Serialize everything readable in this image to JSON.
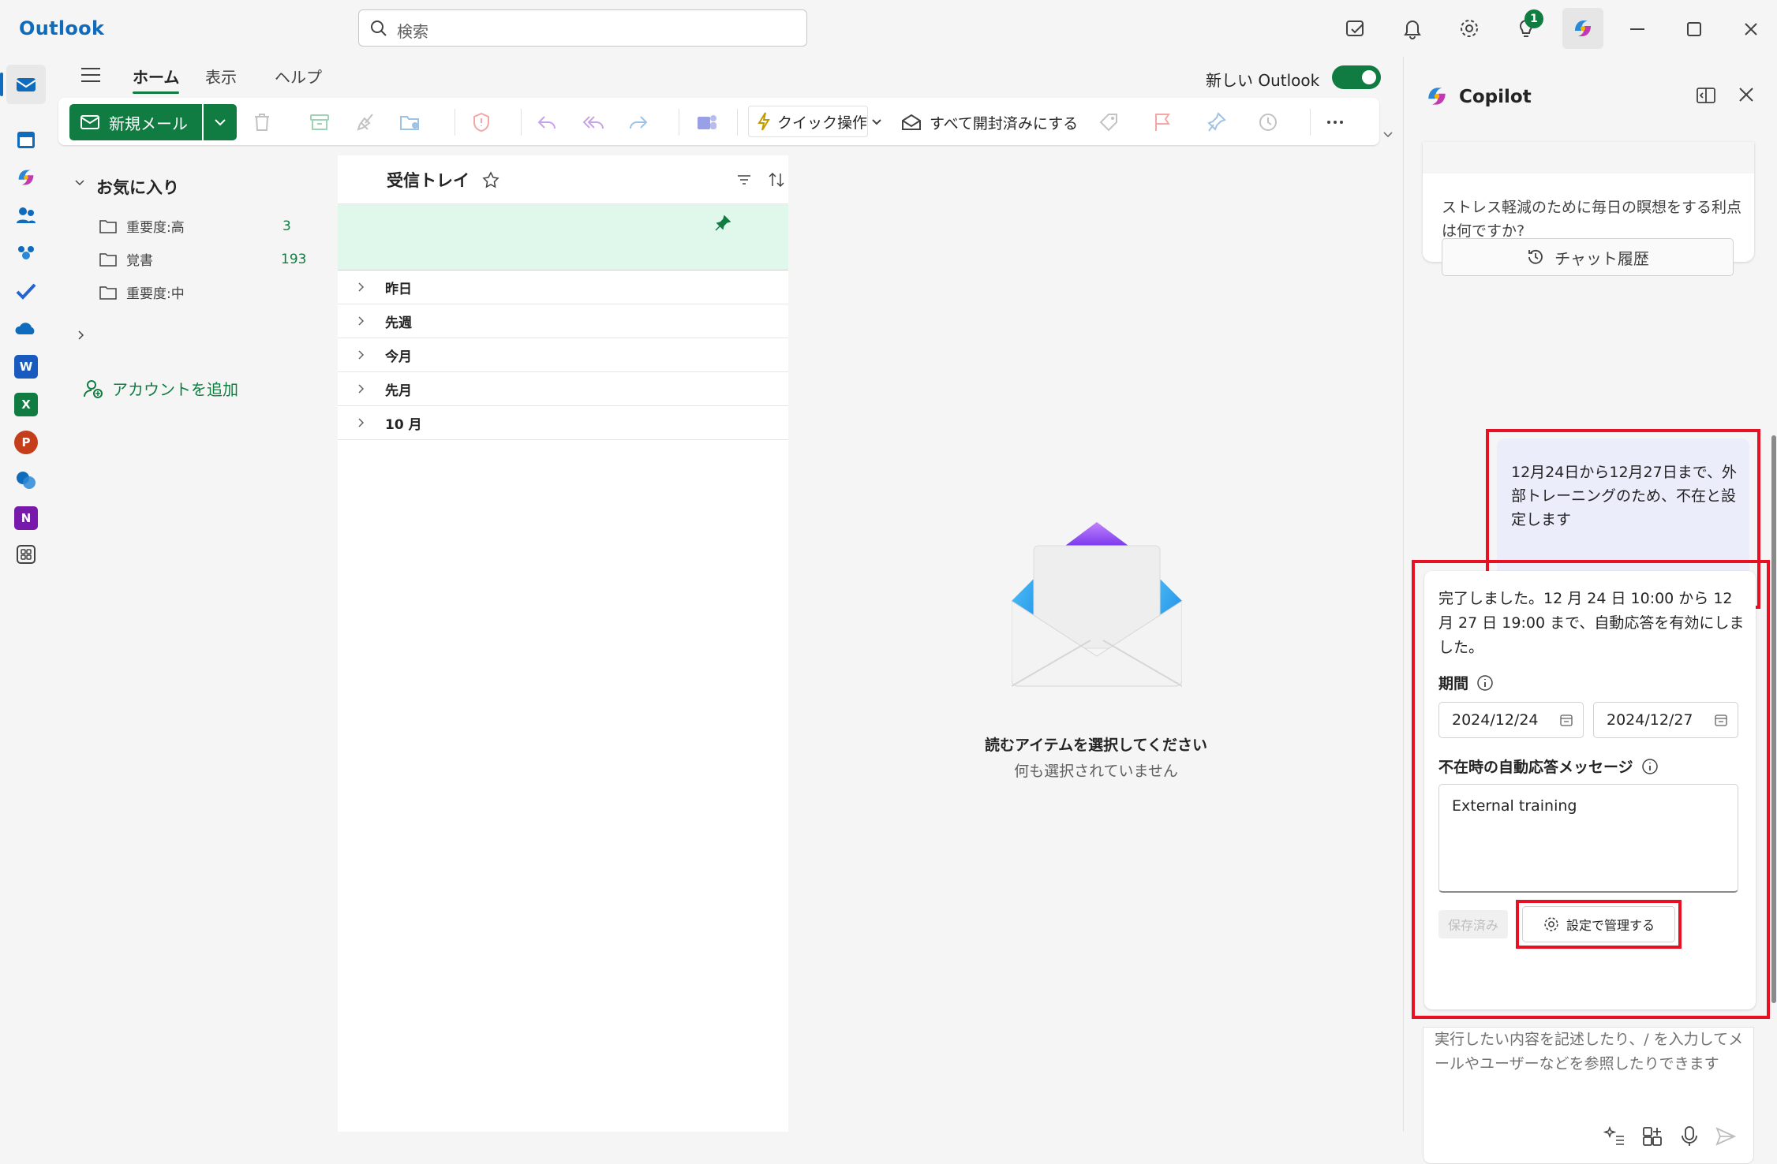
{
  "app": {
    "title": "Outlook"
  },
  "search": {
    "placeholder": "検索"
  },
  "titlebar": {
    "tips_badge": "1"
  },
  "ribbon": {
    "tabs": [
      {
        "label": "ホーム"
      },
      {
        "label": "表示"
      },
      {
        "label": "ヘルプ"
      }
    ],
    "new_outlook_label": "新しい Outlook",
    "new_mail_label": "新規メール",
    "quick_steps_label": "クイック操作",
    "mark_all_read_label": "すべて開封済みにする"
  },
  "folders": {
    "favorites_label": "お気に入り",
    "items": [
      {
        "name": "重要度:高",
        "count": "3"
      },
      {
        "name": "覚書",
        "count": "193"
      },
      {
        "name": "重要度:中",
        "count": ""
      }
    ],
    "add_account_label": "アカウントを追加"
  },
  "message_list": {
    "title": "受信トレイ",
    "groups": [
      {
        "label": "昨日"
      },
      {
        "label": "先週"
      },
      {
        "label": "今月"
      },
      {
        "label": "先月"
      },
      {
        "label": "10 月"
      }
    ]
  },
  "reading_pane": {
    "empty_title": "読むアイテムを選択してください",
    "empty_subtitle": "何も選択されていません"
  },
  "copilot": {
    "title": "Copilot",
    "prev_prompt": "ストレス軽減のために毎日の瞑想をする利点は何ですか?",
    "chat_history_label": "チャット履歴",
    "user_message": "12月24日から12月27日まで、外部トレーニングのため、不在と設定します",
    "response": {
      "text": "完了しました。12 月 24 日 10:00 から 12 月 27 日 19:00 まで、自動応答を有効にしました。",
      "period_label": "期間",
      "start_date": "2024/12/24",
      "end_date": "2024/12/27",
      "auto_reply_label": "不在時の自動応答メッセージ",
      "auto_reply_text": "External training",
      "saved_label": "保存済み",
      "manage_label": "設定で管理する"
    },
    "input_placeholder": "実行したい内容を記述したり、/ を入力してメールやユーザーなどを参照したりできます"
  },
  "colors": {
    "accent": "#107c41",
    "highlight": "#e81123",
    "pinned_bg": "#e0f7ec",
    "user_bubble": "#ebedfb"
  }
}
